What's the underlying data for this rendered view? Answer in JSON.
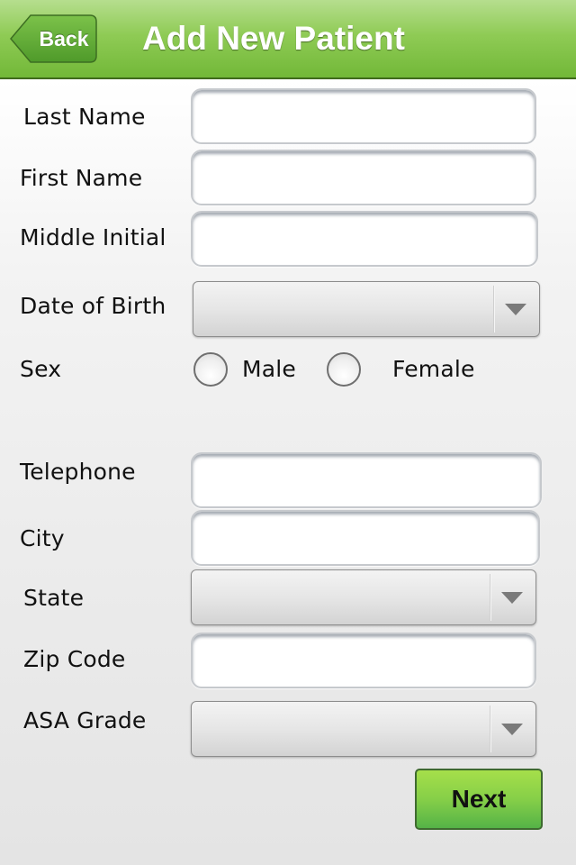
{
  "navbar": {
    "back_label": "Back",
    "title": "Add New Patient"
  },
  "form": {
    "last_name": {
      "label": "Last Name",
      "value": ""
    },
    "first_name": {
      "label": "First Name",
      "value": ""
    },
    "middle_initial": {
      "label": "Middle Initial",
      "value": ""
    },
    "date_of_birth": {
      "label": "Date of Birth",
      "selected": ""
    },
    "sex": {
      "label": "Sex",
      "options": [
        "Male",
        "Female"
      ],
      "selected": null
    },
    "telephone": {
      "label": "Telephone",
      "value": ""
    },
    "city": {
      "label": "City",
      "value": ""
    },
    "state": {
      "label": "State",
      "selected": ""
    },
    "zip_code": {
      "label": "Zip Code",
      "value": ""
    },
    "asa_grade": {
      "label": "ASA Grade",
      "selected": ""
    }
  },
  "actions": {
    "next_label": "Next"
  },
  "colors": {
    "nav_green": "#8fcb55",
    "next_green": "#86cf48"
  }
}
